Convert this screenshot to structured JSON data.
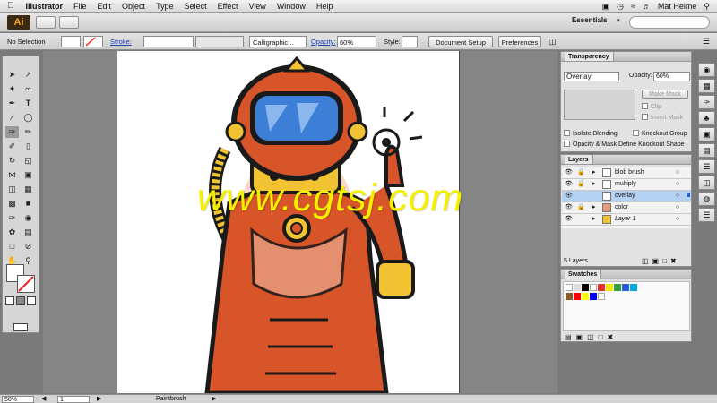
{
  "menubar": {
    "apple": "",
    "app_name": "Illustrator",
    "items": [
      "File",
      "Edit",
      "Object",
      "Type",
      "Select",
      "Effect",
      "View",
      "Window",
      "Help"
    ],
    "user": "Mat Helme"
  },
  "appbar": {
    "logo": "Ai",
    "workspace": "Essentials"
  },
  "controlbar": {
    "selection": "No Selection",
    "stroke_label": "Stroke:",
    "brush": "Calligraphic...",
    "opacity_label": "Opacity:",
    "opacity_value": "60%",
    "style_label": "Style:",
    "doc_setup": "Document Setup",
    "preferences": "Preferences"
  },
  "watermark": "www.cgtsj.com",
  "transparency": {
    "tab": "Transparency",
    "blend_mode": "Overlay",
    "opacity_label": "Opacity:",
    "opacity_value": "60%",
    "make_mask": "Make Mask",
    "clip": "Clip",
    "invert_mask": "Invert Mask",
    "isolate": "Isolate Blending",
    "knockout": "Knockout Group",
    "opacity_mask": "Opacity & Mask Define Knockout Shape"
  },
  "layers": {
    "tab": "Layers",
    "rows": [
      {
        "name": "blob brush",
        "selected": false,
        "locked": true
      },
      {
        "name": "multiply",
        "selected": false,
        "locked": true
      },
      {
        "name": "overlay",
        "selected": true,
        "locked": false
      },
      {
        "name": "color",
        "selected": false,
        "locked": true
      },
      {
        "name": "Layer 1",
        "selected": false,
        "locked": false
      }
    ],
    "count": "5 Layers"
  },
  "swatches": {
    "tab": "Swatches",
    "colors": [
      "#ffffff",
      "#000000",
      "#e8302a",
      "#f7e600",
      "#3aa03a",
      "#2a5ed8",
      "#ff7f00",
      "#00a9e0",
      "#ec008c",
      "#8b5a2b",
      "#ff0000",
      "#ffff00",
      "#0000ff",
      "#ffffff"
    ]
  },
  "status": {
    "zoom": "50%",
    "page": "1",
    "tool": "Paintbrush"
  },
  "colors": {
    "suit": "#d8552a",
    "suit_dark": "#b8441f",
    "yellow": "#f1c232",
    "visor": "#3d7fd6",
    "outline": "#1a1a1a",
    "accent": "#b3d1f0"
  }
}
